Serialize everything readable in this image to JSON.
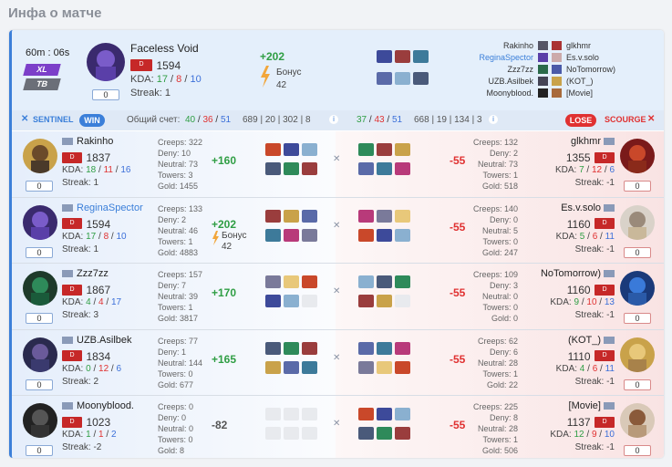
{
  "title": "Инфа о матче",
  "match": {
    "time": "60m : 06s",
    "badge1": "XL",
    "badge2": "TB",
    "hero": "Faceless Void",
    "rank": "1594",
    "kda_label": "KDA:",
    "kda": [
      "17",
      "8",
      "10"
    ],
    "streak": "Streak: 1",
    "zero": "0",
    "gain": "+202",
    "bonus_label": "Бонус",
    "bonus_value": "42",
    "mini_players": [
      {
        "left": "Rakinho",
        "right": "glkhmr"
      },
      {
        "left": "ReginaSpector",
        "right": "Es.v.solo"
      },
      {
        "left": "Zzz7zz",
        "right": "NoTomorrow)"
      },
      {
        "left": "UZB.Asilbek",
        "right": "(KOT_)"
      },
      {
        "left": "Moonyblood.",
        "right": "[Movie]"
      }
    ]
  },
  "bar": {
    "sentinel": "SENTINEL",
    "win": "WIN",
    "score_label": "Общий счет:",
    "left_kda": [
      "40",
      "36",
      "51"
    ],
    "left_other": "689 | 20 | 302 | 8",
    "right_kda": [
      "37",
      "43",
      "51"
    ],
    "right_other": "668 | 19 | 134 | 3",
    "lose": "LOSE",
    "scourge": "SCOURGE"
  },
  "rows": [
    {
      "left": {
        "name": "Rakinho",
        "rank": "1837",
        "kda": [
          "18",
          "11",
          "16"
        ],
        "streak": "Streak: 1",
        "zero": "0",
        "creeps": "Creeps: 322",
        "deny": "Deny: 10",
        "neutral": "Neutral: 73",
        "towers": "Towers: 3",
        "gold": "Gold: 1455",
        "gain": "+160",
        "bonus": false
      },
      "right": {
        "name": "glkhmr",
        "rank": "1355",
        "kda": [
          "7",
          "12",
          "6"
        ],
        "streak": "Streak: -1",
        "zero": "0",
        "creeps": "Creeps: 132",
        "deny": "Deny: 2",
        "neutral": "Neutral: 73",
        "towers": "Towers: 1",
        "gold": "Gold: 518",
        "gain": "-55"
      }
    },
    {
      "left": {
        "name": "ReginaSpector",
        "rank": "1594",
        "kda": [
          "17",
          "8",
          "10"
        ],
        "streak": "Streak: 1",
        "zero": "0",
        "creeps": "Creeps: 133",
        "deny": "Deny: 2",
        "neutral": "Neutral: 46",
        "towers": "Towers: 1",
        "gold": "Gold: 4883",
        "gain": "+202",
        "bonus": true,
        "bonus_label": "Бонус",
        "bonus_value": "42"
      },
      "right": {
        "name": "Es.v.solo",
        "rank": "1160",
        "kda": [
          "5",
          "6",
          "11"
        ],
        "streak": "Streak: -1",
        "zero": "0",
        "creeps": "Creeps: 140",
        "deny": "Deny: 0",
        "neutral": "Neutral: 5",
        "towers": "Towers: 0",
        "gold": "Gold: 247",
        "gain": "-55"
      }
    },
    {
      "left": {
        "name": "Zzz7zz",
        "rank": "1867",
        "kda": [
          "4",
          "4",
          "17"
        ],
        "streak": "Streak: 3",
        "zero": "0",
        "creeps": "Creeps: 157",
        "deny": "Deny: 7",
        "neutral": "Neutral: 39",
        "towers": "Towers: 1",
        "gold": "Gold: 3817",
        "gain": "+170",
        "bonus": false
      },
      "right": {
        "name": "NoTomorrow)",
        "rank": "1160",
        "kda": [
          "9",
          "10",
          "13"
        ],
        "streak": "Streak: -1",
        "zero": "0",
        "creeps": "Creeps: 109",
        "deny": "Deny: 3",
        "neutral": "Neutral: 0",
        "towers": "Towers: 0",
        "gold": "Gold: 0",
        "gain": "-55"
      }
    },
    {
      "left": {
        "name": "UZB.Asilbek",
        "rank": "1834",
        "kda": [
          "0",
          "12",
          "6"
        ],
        "streak": "Streak: 2",
        "zero": "0",
        "creeps": "Creeps: 77",
        "deny": "Deny: 1",
        "neutral": "Neutral: 144",
        "towers": "Towers: 0",
        "gold": "Gold: 677",
        "gain": "+165",
        "bonus": false
      },
      "right": {
        "name": "(KOT_)",
        "rank": "1110",
        "kda": [
          "4",
          "6",
          "11"
        ],
        "streak": "Streak: -1",
        "zero": "0",
        "creeps": "Creeps: 62",
        "deny": "Deny: 6",
        "neutral": "Neutral: 28",
        "towers": "Towers: 1",
        "gold": "Gold: 22",
        "gain": "-55"
      }
    },
    {
      "left": {
        "name": "Moonyblood.",
        "rank": "1023",
        "kda": [
          "1",
          "1",
          "2"
        ],
        "streak": "Streak: -2",
        "zero": "0",
        "creeps": "Creeps: 0",
        "deny": "Deny: 0",
        "neutral": "Neutral: 0",
        "towers": "Towers: 0",
        "gold": "Gold: 8",
        "gain": "-82",
        "bonus": false
      },
      "right": {
        "name": "[Movie]",
        "rank": "1137",
        "kda": [
          "12",
          "9",
          "10"
        ],
        "streak": "Streak: -1",
        "zero": "0",
        "creeps": "Creeps: 225",
        "deny": "Deny: 8",
        "neutral": "Neutral: 28",
        "towers": "Towers: 1",
        "gold": "Gold: 506",
        "gain": "-55"
      }
    }
  ],
  "colors": {
    "sentinel": "#3b7fd9",
    "scourge": "#e03131",
    "win": "#3b7fd9",
    "lose": "#e03131",
    "kill": "#2f9e44",
    "death": "#e03131",
    "assist": "#3b6fd9"
  },
  "icons": [
    "crossed-swords-icon",
    "bolt-icon",
    "info-icon",
    "flag-icon",
    "hero-portrait",
    "item-icon"
  ]
}
